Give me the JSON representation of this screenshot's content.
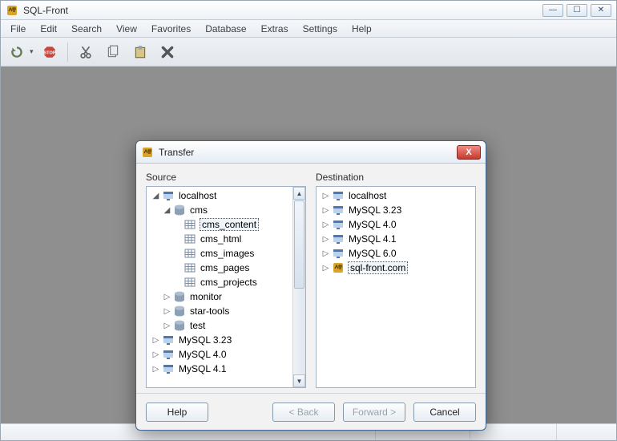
{
  "app": {
    "title": "SQL-Front"
  },
  "menu": [
    "File",
    "Edit",
    "Search",
    "View",
    "Favorites",
    "Database",
    "Extras",
    "Settings",
    "Help"
  ],
  "dialog": {
    "title": "Transfer",
    "source_label": "Source",
    "destination_label": "Destination",
    "buttons": {
      "help": "Help",
      "back": "< Back",
      "forward": "Forward >",
      "cancel": "Cancel"
    }
  },
  "source_tree": {
    "localhost": "localhost",
    "cms": "cms",
    "cms_tables": [
      "cms_content",
      "cms_html",
      "cms_images",
      "cms_pages",
      "cms_projects"
    ],
    "other_dbs": [
      "monitor",
      "star-tools",
      "test"
    ],
    "servers": [
      "MySQL 3.23",
      "MySQL 4.0",
      "MySQL 4.1"
    ],
    "selected": "cms_content"
  },
  "dest_tree": {
    "items": [
      "localhost",
      "MySQL 3.23",
      "MySQL 4.0",
      "MySQL 4.1",
      "MySQL 6.0",
      "sql-front.com"
    ],
    "selected": "sql-front.com"
  }
}
